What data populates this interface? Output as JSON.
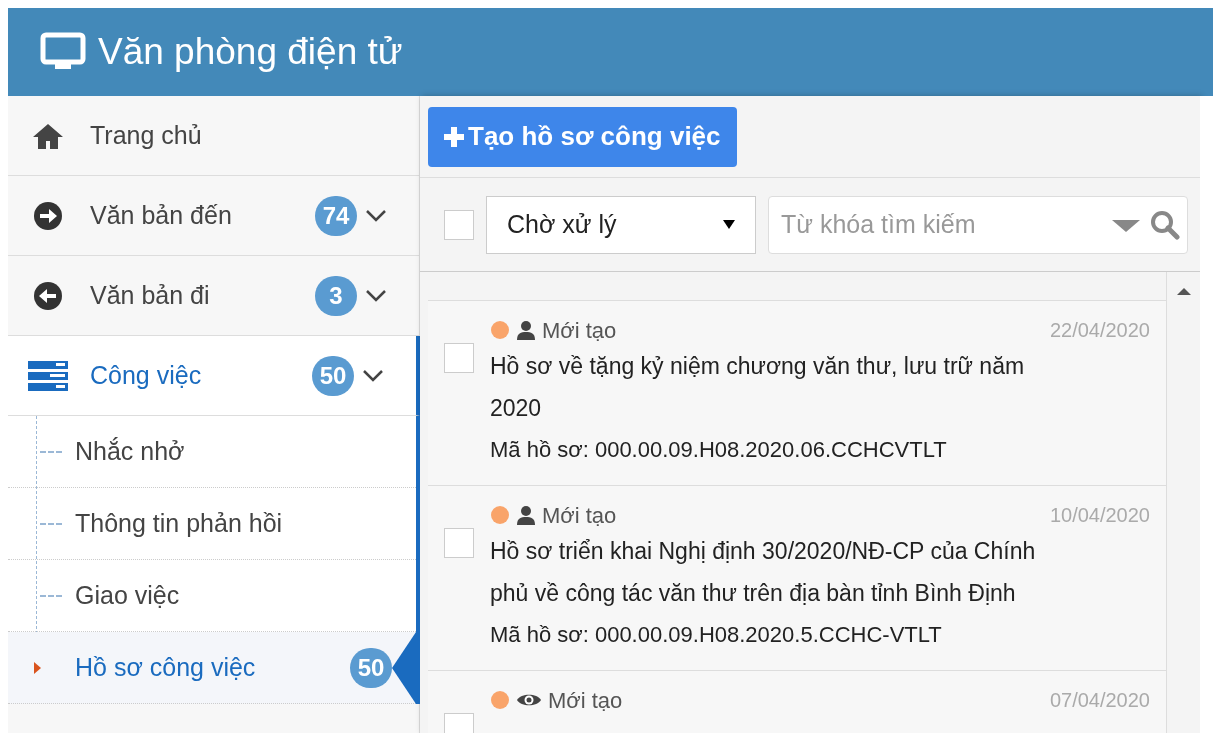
{
  "header": {
    "title": "Văn phòng điện tử"
  },
  "sidebar": {
    "items": [
      {
        "label": "Trang chủ",
        "kind": "home",
        "selected": false
      },
      {
        "label": "Văn bản đến",
        "kind": "incoming",
        "badge": "74",
        "selected": false
      },
      {
        "label": "Văn bản đi",
        "kind": "outgoing",
        "badge": "3",
        "selected": false
      },
      {
        "label": "Công việc",
        "kind": "tasks",
        "badge": "50",
        "selected": true,
        "children": [
          {
            "label": "Nhắc nhở",
            "selected": false
          },
          {
            "label": "Thông tin phản hồi",
            "selected": false
          },
          {
            "label": "Giao việc",
            "selected": false
          },
          {
            "label": "Hồ sơ công việc",
            "badge": "50",
            "selected": true
          }
        ]
      }
    ]
  },
  "toolbar": {
    "create_button": "Tạo hồ sơ công việc"
  },
  "filter": {
    "select_all": {
      "checked": false
    },
    "status": "Chờ xử lý",
    "search": {
      "placeholder": "Từ khóa tìm kiếm"
    }
  },
  "records": [
    {
      "kind": "assigned",
      "status": "Mới tạo",
      "date": "22/04/2020",
      "title": "Hồ sơ về tặng kỷ niệm chương văn thư, lưu trữ năm 2020",
      "code": "Mã hồ sơ: 000.00.09.H08.2020.06.CCHCVTLT",
      "checked": false
    },
    {
      "kind": "assigned",
      "status": "Mới tạo",
      "date": "10/04/2020",
      "title": "Hồ sơ triển khai Nghị định 30/2020/NĐ-CP của Chính phủ về công tác văn thư trên địa bàn tỉnh Bình Định",
      "code": "Mã hồ sơ: 000.00.09.H08.2020.5.CCHC-VTLT",
      "checked": false
    },
    {
      "kind": "watched",
      "status": "Mới tạo",
      "date": "07/04/2020",
      "checked": false
    }
  ]
}
